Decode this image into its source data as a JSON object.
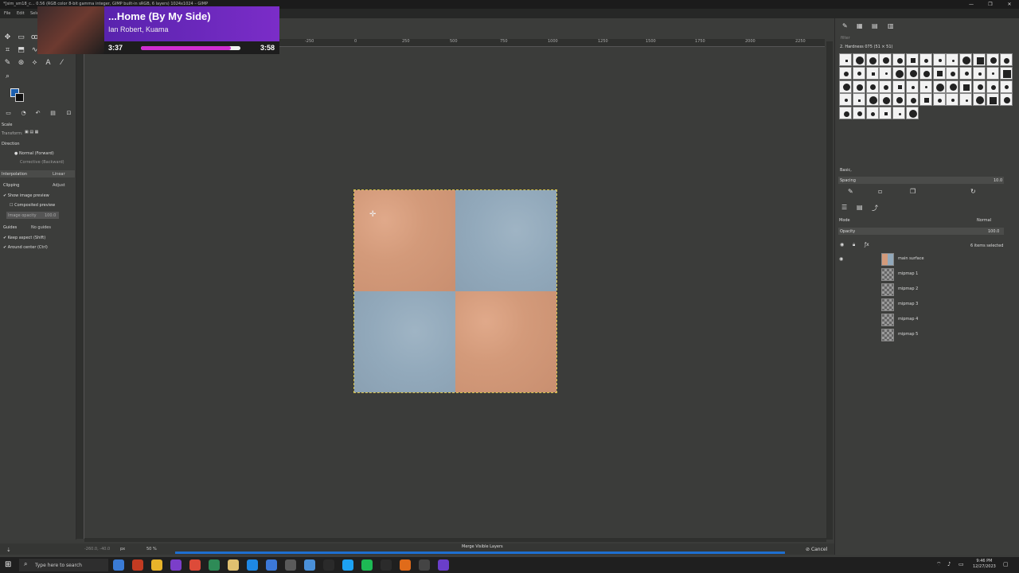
{
  "window": {
    "title": "*[sim_sm18_c... 0.56 (RGB color 8-bit gamma integer, GIMP built-in sRGB, 6 layers) 1024x1024 – GIMP",
    "controls": [
      "—",
      "❐",
      "✕"
    ]
  },
  "menu": {
    "items": [
      "File",
      "Edit",
      "Select"
    ]
  },
  "now_playing": {
    "title": "...Home (By My Side)",
    "artist": "Ian Robert, Kuama",
    "elapsed": "3:37",
    "total": "3:58",
    "progress": 0.9
  },
  "tool_options": {
    "section": "Scale",
    "transform_label": "Transform:",
    "direction_label": "Direction",
    "direction_options": [
      "Normal (Forward)",
      "Corrective (Backward)"
    ],
    "interpolation_label": "Interpolation",
    "interpolation_value": "Linear",
    "clipping_label": "Clipping",
    "clipping_value": "Adjust",
    "show_preview": "Show image preview",
    "composited_preview": "Composited preview",
    "image_opacity_label": "Image opacity",
    "image_opacity_value": "100.0",
    "guides_label": "Guides",
    "guides_value": "No guides",
    "keep_aspect": "Keep aspect (Shift)",
    "around_center": "Around center (Ctrl)"
  },
  "ruler": {
    "ticks": [
      "-250",
      "0",
      "250",
      "500",
      "750",
      "1000",
      "1250",
      "1500",
      "1750",
      "2000",
      "2250"
    ]
  },
  "status": {
    "coords": "-260.0, -40.0",
    "unit": "px",
    "zoom": "50 %",
    "progress_label": "Merge Visible Layers",
    "cancel_label": "Cancel",
    "progress": 1.0
  },
  "brushes": {
    "filter_placeholder": "filter",
    "current_brush": "2. Hardness 075 (51 × 51)",
    "preset_label": "Basic,",
    "spacing_label": "Spacing",
    "spacing_value": "10.0"
  },
  "layers": {
    "mode_label": "Mode",
    "mode_value": "Normal",
    "opacity_label": "Opacity",
    "opacity_value": "100.0",
    "selected_count": "6 items selected",
    "items": [
      {
        "name": "main surface"
      },
      {
        "name": "mipmap 1"
      },
      {
        "name": "mipmap 2"
      },
      {
        "name": "mipmap 3"
      },
      {
        "name": "mipmap 4"
      },
      {
        "name": "mipmap 5"
      }
    ]
  },
  "taskbar": {
    "search_placeholder": "Type here to search",
    "time": "9:46 PM",
    "date": "12/27/2023",
    "apps": [
      "#3a7bd5",
      "#c23b22",
      "#e8b42a",
      "#7b3ec9",
      "#dd4b39",
      "#2e8b57",
      "#e0c070",
      "#1e88e5",
      "#3c78d8",
      "#5a5a5a",
      "#4a90d9",
      "#2a2a2a",
      "#1da1f2",
      "#1db954",
      "#2b2b2b",
      "#e06b1a",
      "#444444",
      "#6a3ec9"
    ]
  },
  "colors": {
    "foreground": "#1c5fae",
    "background": "#111111",
    "tile_orange": "#d39a7a",
    "tile_blue": "#92a9bb",
    "now_playing_accent": "#cf2ed0"
  }
}
